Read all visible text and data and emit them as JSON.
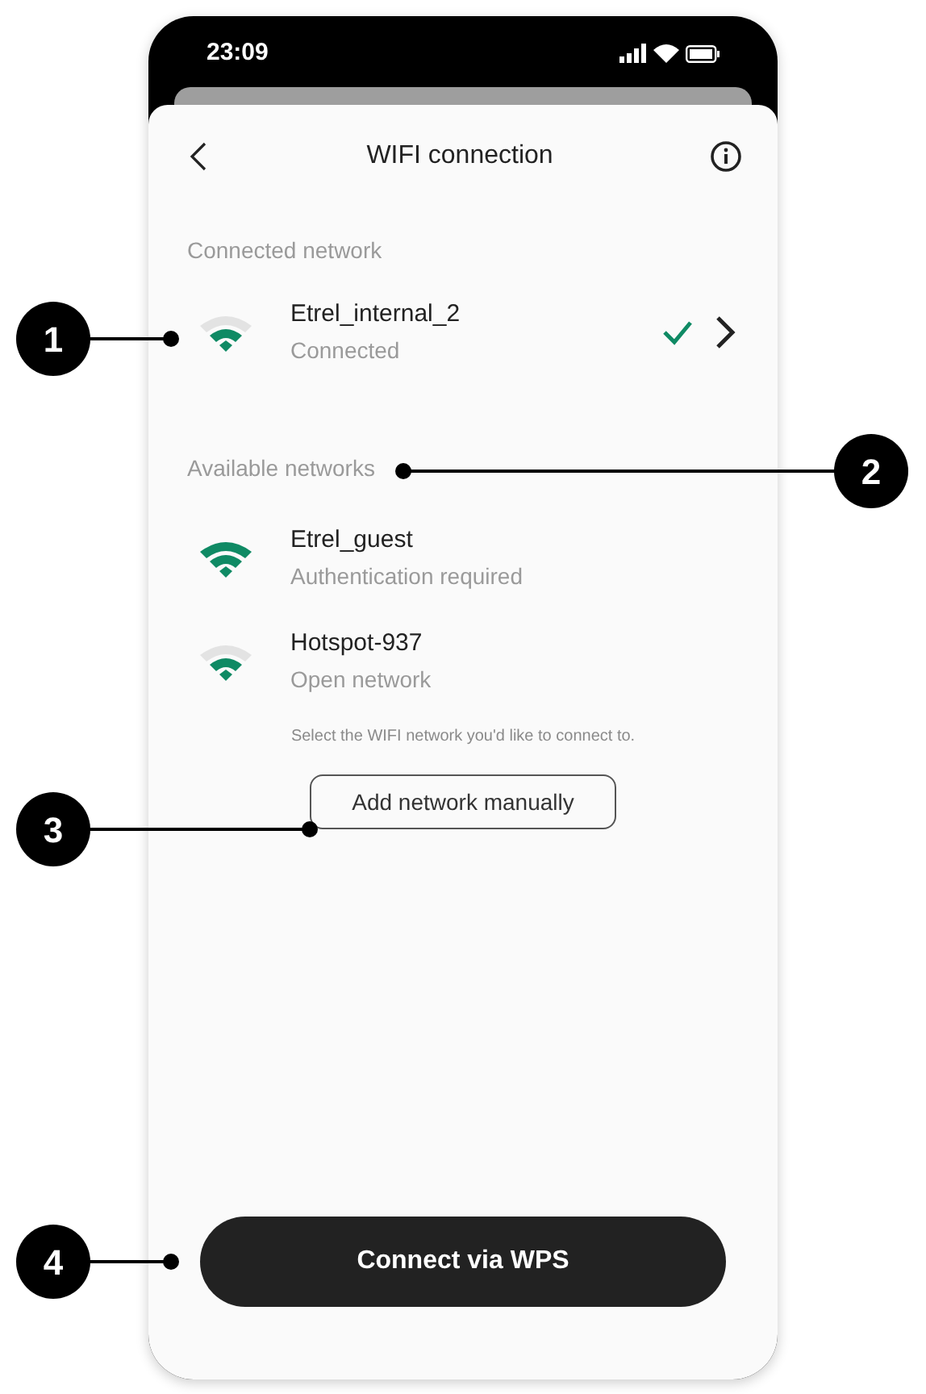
{
  "status_bar": {
    "time": "23:09"
  },
  "header": {
    "title": "WIFI connection"
  },
  "connected_section": {
    "heading": "Connected network",
    "networks": [
      {
        "name": "Etrel_internal_2",
        "status": "Connected",
        "kind": "medium",
        "connected": true
      }
    ]
  },
  "available_section": {
    "heading": "Available networks",
    "networks": [
      {
        "name": "Etrel_guest",
        "status": "Authentication required",
        "kind": "strong",
        "connected": false
      },
      {
        "name": "Hotspot-937",
        "status": "Open network",
        "kind": "medium",
        "connected": false
      }
    ]
  },
  "hint": "Select the WIFI network you'd like to connect to.",
  "add_button": "Add network manually",
  "wps_button": "Connect via WPS",
  "callouts": [
    {
      "label": "1"
    },
    {
      "label": "2"
    },
    {
      "label": "3"
    },
    {
      "label": "4"
    }
  ]
}
